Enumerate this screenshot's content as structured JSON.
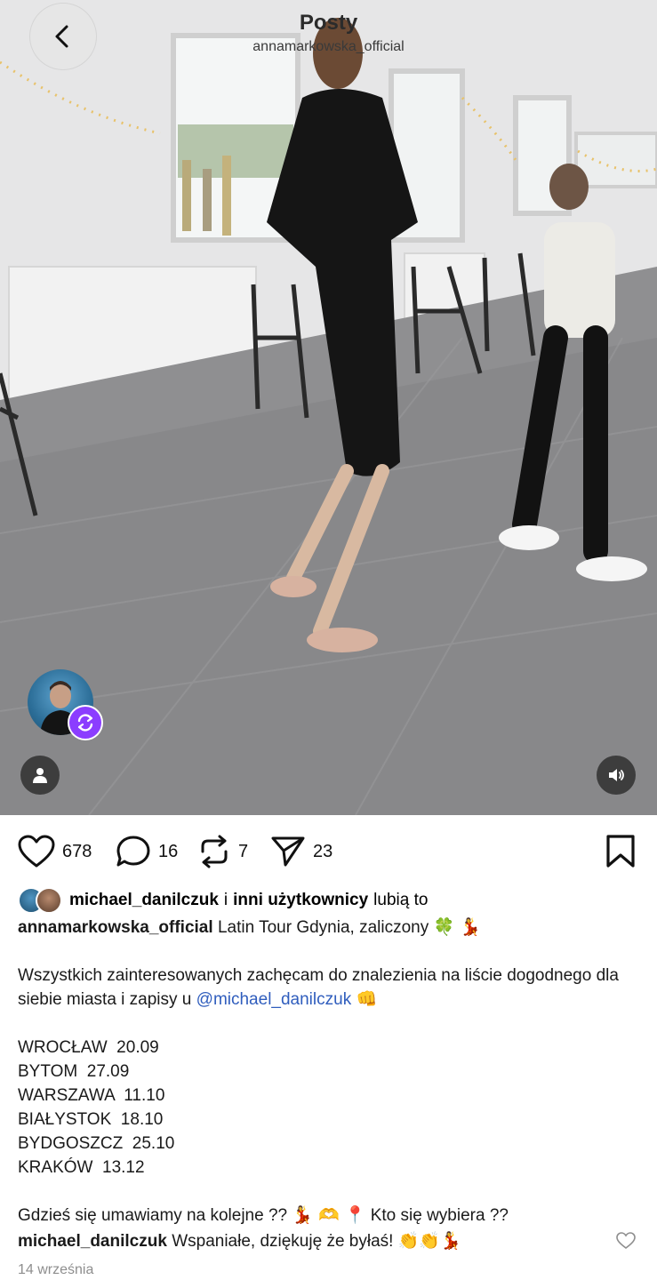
{
  "header": {
    "title": "Posty",
    "subtitle": "annamarkowska_official"
  },
  "icons": {
    "back": "chevron-left-icon",
    "repost_badge": "repost-icon",
    "profile": "person-icon",
    "sound": "speaker-icon",
    "like": "heart-icon",
    "comment": "comment-bubble-icon",
    "repost": "repost-arrows-icon",
    "share": "send-paper-plane-icon",
    "save": "bookmark-icon"
  },
  "colors": {
    "accent_purple": "#8b3dff",
    "mention_blue": "#2f5dbd",
    "muted_gray": "#8e8e8e"
  },
  "actions": {
    "likes": "678",
    "comments": "16",
    "reposts": "7",
    "shares": "23"
  },
  "liked_by": {
    "user": "michael_danilczuk",
    "connector": "i",
    "others": "inni użytkownicy",
    "suffix": "lubią to"
  },
  "caption": {
    "author": "annamarkowska_official",
    "line1": "Latin Tour Gdynia, zaliczony",
    "line1_emoji": "🍀 💃",
    "para2_text": "Wszystkich zainteresowanych zachęcam do znalezienia na liście dogodnego dla siebie miasta i zapisy u",
    "para2_mention": "@michael_danilczuk",
    "para2_emoji": "👊",
    "schedule": [
      "WROCŁAW  20.09",
      "BYTOM  27.09",
      "WARSZAWA  11.10",
      "BIAŁYSTOK  18.10",
      "BYDGOSZCZ  25.10",
      "KRAKÓW  13.12"
    ],
    "closing_a": "Gdzieś się umawiamy na kolejne ??",
    "closing_emoji": "💃 🫶 📍",
    "closing_b": "Kto się wybiera ??"
  },
  "comment": {
    "author": "michael_danilczuk",
    "text": "Wspaniałe, dziękuję że byłaś!",
    "emoji": "👏👏💃"
  },
  "date": "14 września"
}
